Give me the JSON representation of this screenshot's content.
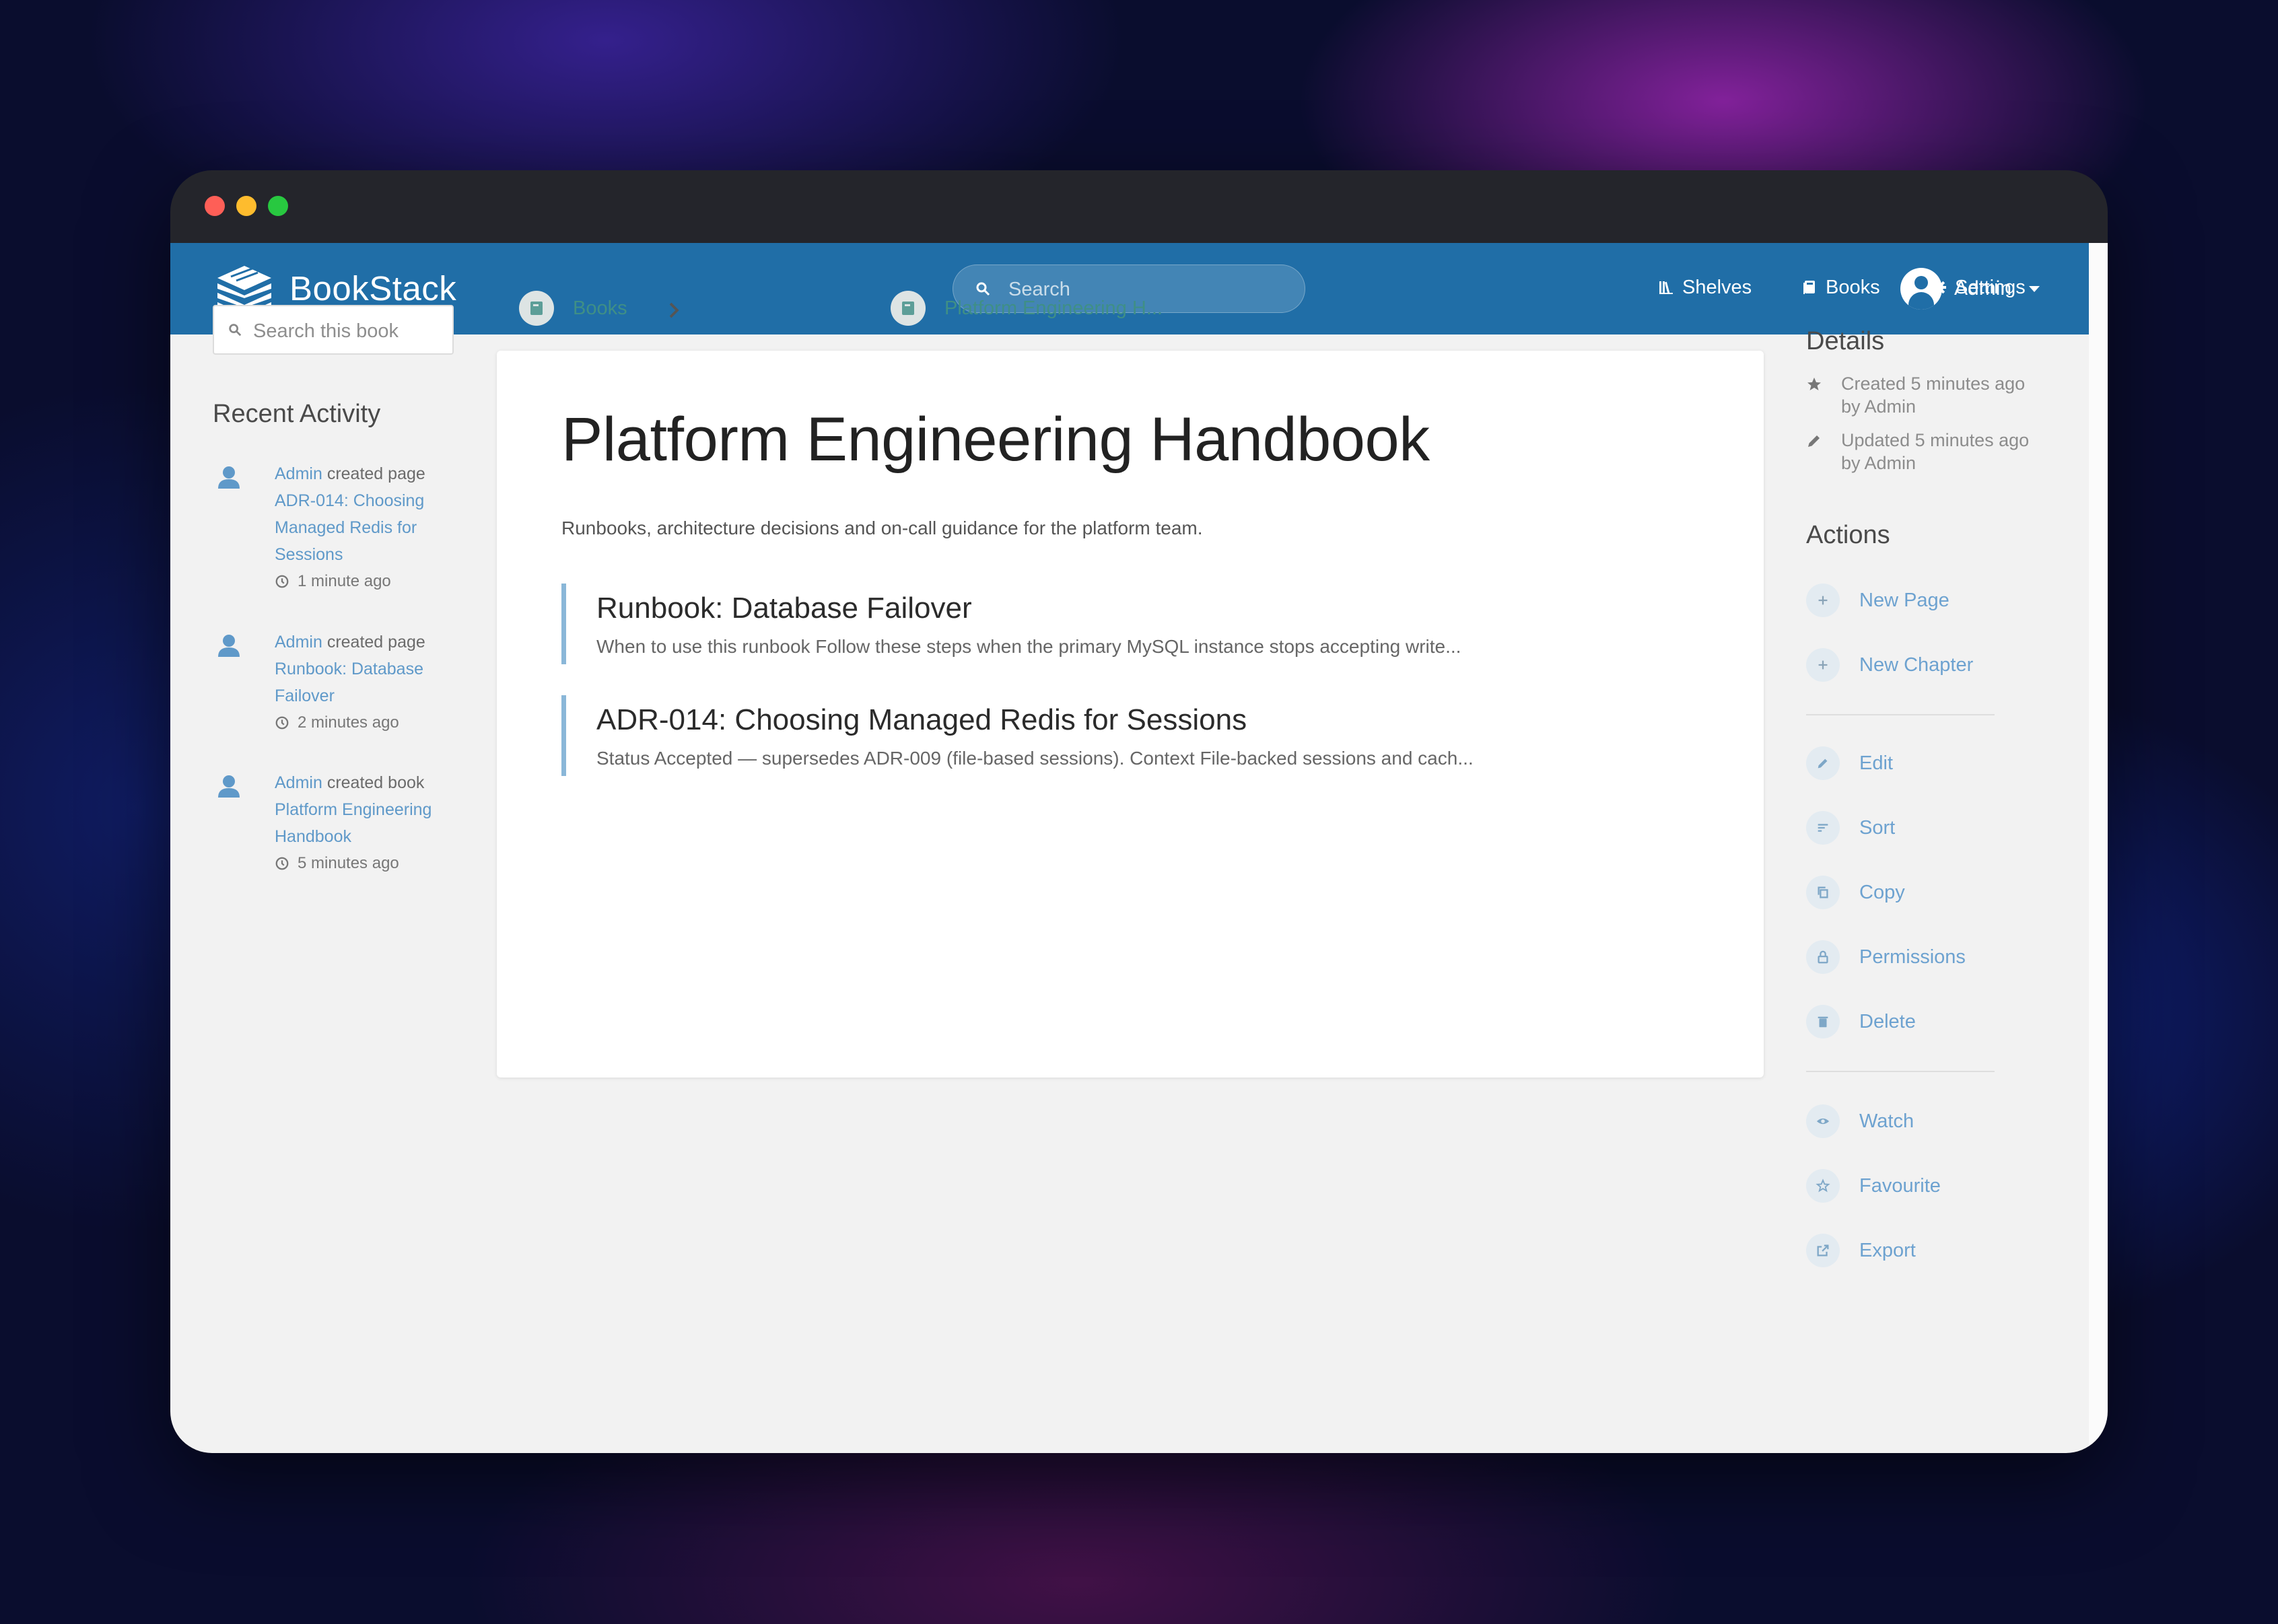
{
  "app": {
    "brand": "BookStack",
    "search_placeholder": "Search",
    "nav": [
      {
        "label": "Shelves",
        "icon": "shelves-icon"
      },
      {
        "label": "Books",
        "icon": "books-icon"
      },
      {
        "label": "Settings",
        "icon": "gear-icon"
      }
    ],
    "user": {
      "name": "Admin"
    }
  },
  "sidebar_left": {
    "search_placeholder": "Search this book",
    "recent_activity_heading": "Recent Activity",
    "activity": [
      {
        "user": "Admin",
        "action": "created page",
        "target_lines": [
          "ADR-014: Choosing",
          "Managed Redis for",
          "Sessions"
        ],
        "time": "1 minute ago"
      },
      {
        "user": "Admin",
        "action": "created page",
        "target_lines": [
          "Runbook: Database",
          "Failover"
        ],
        "time": "2 minutes ago"
      },
      {
        "user": "Admin",
        "action": "created book",
        "target_lines": [
          "Platform Engineering",
          "Handbook"
        ],
        "time": "5 minutes ago"
      }
    ]
  },
  "breadcrumbs": [
    {
      "label": "Books"
    },
    {
      "label": "Platform Engineering H..."
    }
  ],
  "book": {
    "title": "Platform Engineering Handbook",
    "description": "Runbooks, architecture decisions and on-call guidance for the platform team.",
    "pages": [
      {
        "title": "Runbook: Database Failover",
        "excerpt": "When to use this runbook Follow these steps when the primary MySQL instance stops accepting write..."
      },
      {
        "title": "ADR-014: Choosing Managed Redis for Sessions",
        "excerpt": "Status Accepted — supersedes ADR-009 (file-based sessions). Context File-backed sessions and cach..."
      }
    ]
  },
  "sidebar_right": {
    "details_heading": "Details",
    "details": [
      {
        "icon": "star-icon",
        "lines": [
          "Created 5 minutes ago",
          "by Admin"
        ]
      },
      {
        "icon": "pencil-icon",
        "lines": [
          "Updated 5 minutes ago",
          "by Admin"
        ]
      }
    ],
    "actions_heading": "Actions",
    "actions": [
      {
        "label": "New Page",
        "icon": "plus-icon"
      },
      {
        "label": "New Chapter",
        "icon": "plus-icon"
      },
      {
        "label": "Edit",
        "icon": "pencil-icon"
      },
      {
        "label": "Sort",
        "icon": "sort-icon"
      },
      {
        "label": "Copy",
        "icon": "copy-icon"
      },
      {
        "label": "Permissions",
        "icon": "lock-icon"
      },
      {
        "label": "Delete",
        "icon": "trash-icon"
      },
      {
        "label": "Watch",
        "icon": "eye-icon"
      },
      {
        "label": "Favourite",
        "icon": "star-outline-icon"
      },
      {
        "label": "Export",
        "icon": "export-icon"
      }
    ]
  },
  "colors": {
    "header": "#206ea7",
    "link": "#5f99c9",
    "breadcrumb": "#3f8f86",
    "action": "#6da2d0"
  }
}
